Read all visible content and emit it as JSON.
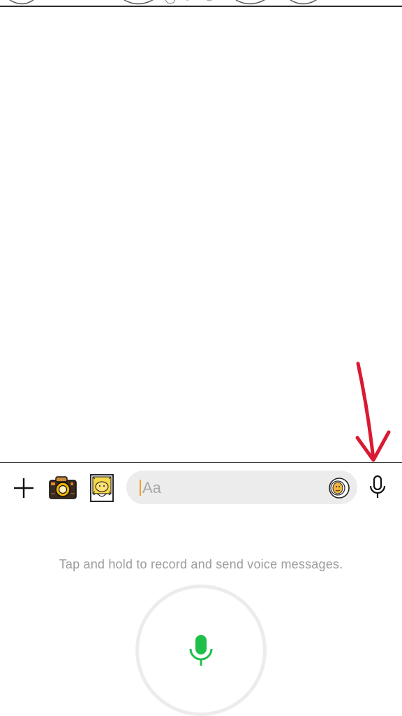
{
  "composer": {
    "placeholder": "Aa"
  },
  "toolbar": {
    "plus_icon": "plus-icon",
    "camera_icon": "camera-sticker-icon",
    "photo_icon": "photo-sticker-icon",
    "emoji_icon": "emoji-icon",
    "mic_icon": "microphone-icon"
  },
  "voice": {
    "hint": "Tap and hold to record and send voice messages.",
    "record_icon": "microphone-icon",
    "accent_color": "#1fbf4a"
  },
  "annotation": {
    "color": "#d91a32"
  }
}
